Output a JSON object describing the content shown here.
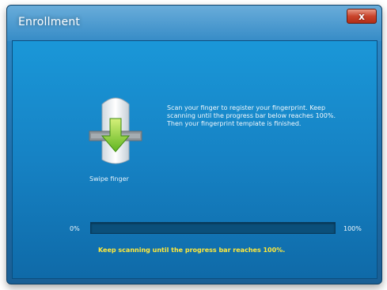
{
  "window": {
    "title": "Enrollment",
    "close_glyph": "x"
  },
  "finger": {
    "label": "Swipe finger",
    "icon": "finger-swipe-icon"
  },
  "instructions": {
    "text": "Scan your finger to register your fingerprint. Keep scanning until the progress bar below reaches 100%.  Then your fingerprint template is finished."
  },
  "progress": {
    "min_label": "0%",
    "max_label": "100%",
    "value_percent": 0
  },
  "hint": {
    "text": "Keep scanning until the progress bar reaches 100%."
  },
  "colors": {
    "accent": "#1682c4",
    "hint": "#ffe93b",
    "close": "#c9442b",
    "arrow": "#7fd12b"
  }
}
